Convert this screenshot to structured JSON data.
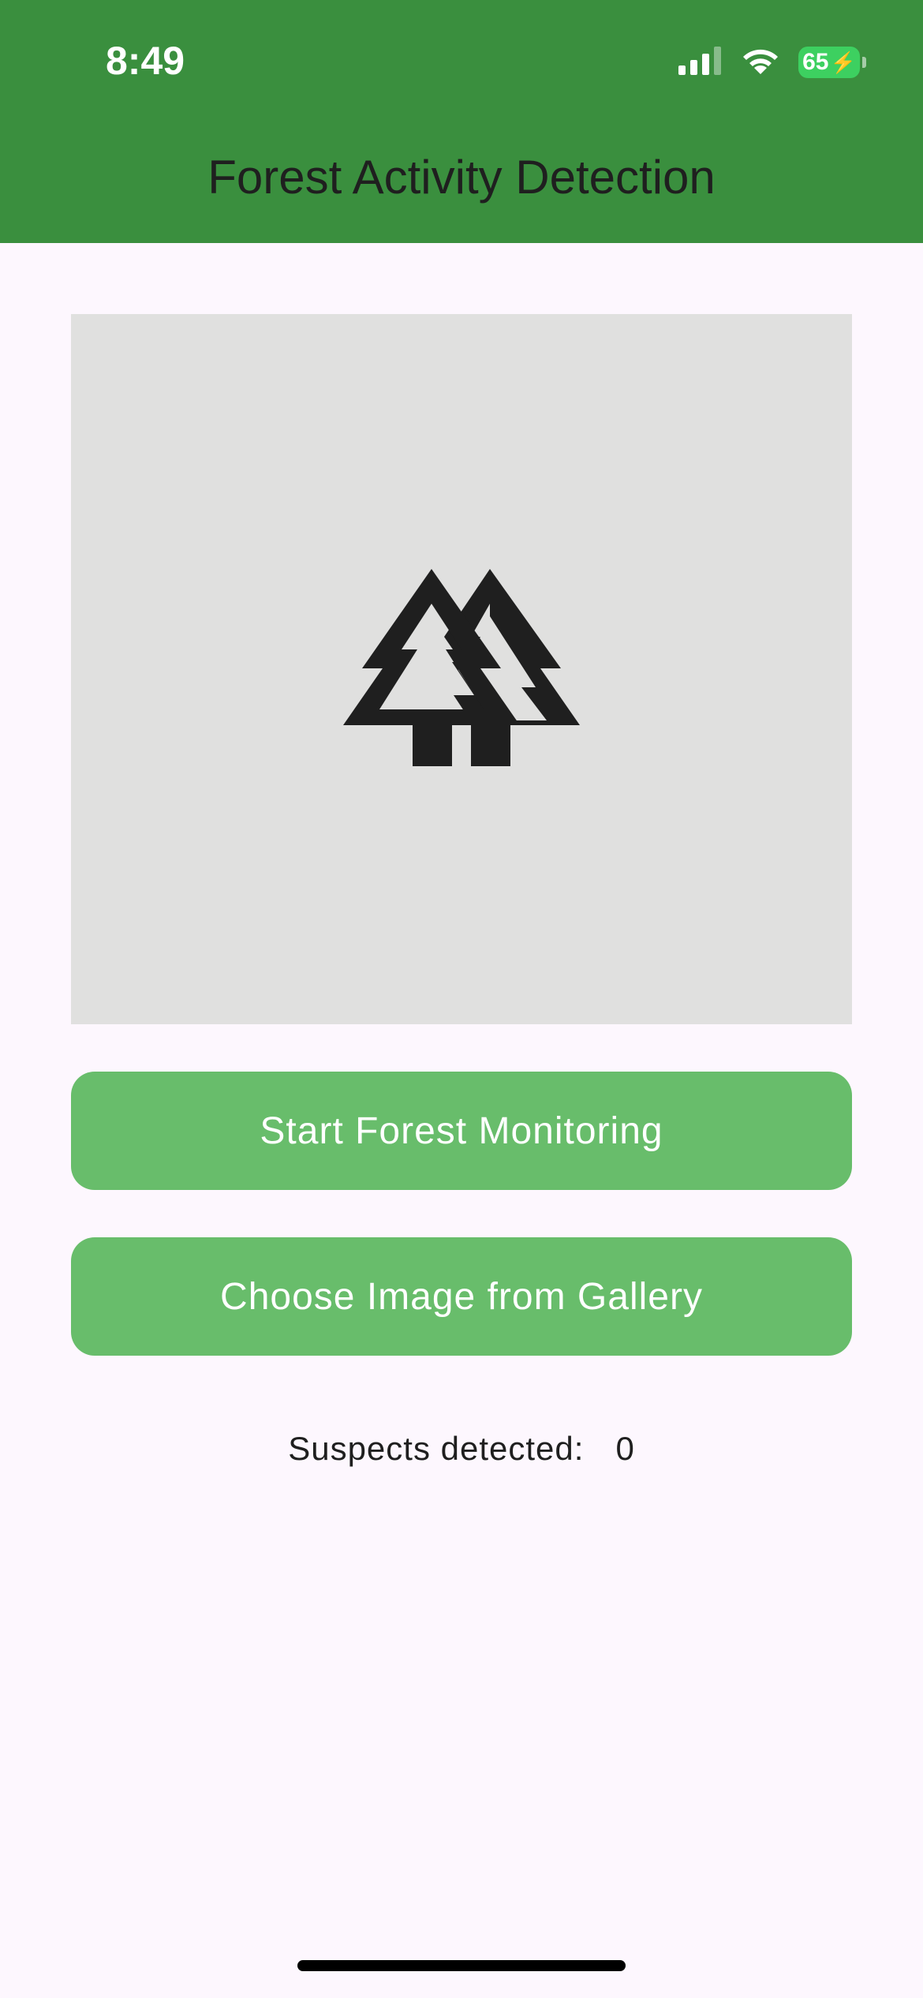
{
  "status_bar": {
    "time": "8:49",
    "battery_level": "65",
    "icons": [
      "cellular-signal-icon",
      "wifi-icon",
      "battery-charging-icon"
    ]
  },
  "app_bar": {
    "title": "Forest Activity Detection",
    "background_color": "#3a8f3e"
  },
  "image_preview": {
    "placeholder_icon": "forest-trees-icon",
    "background_color": "#e0e0df"
  },
  "actions": {
    "start_monitoring_label": "Start Forest Monitoring",
    "choose_gallery_label": "Choose Image from Gallery",
    "button_color": "#68bd6b"
  },
  "results": {
    "suspects_label": "Suspects detected:",
    "suspects_count": "0"
  }
}
